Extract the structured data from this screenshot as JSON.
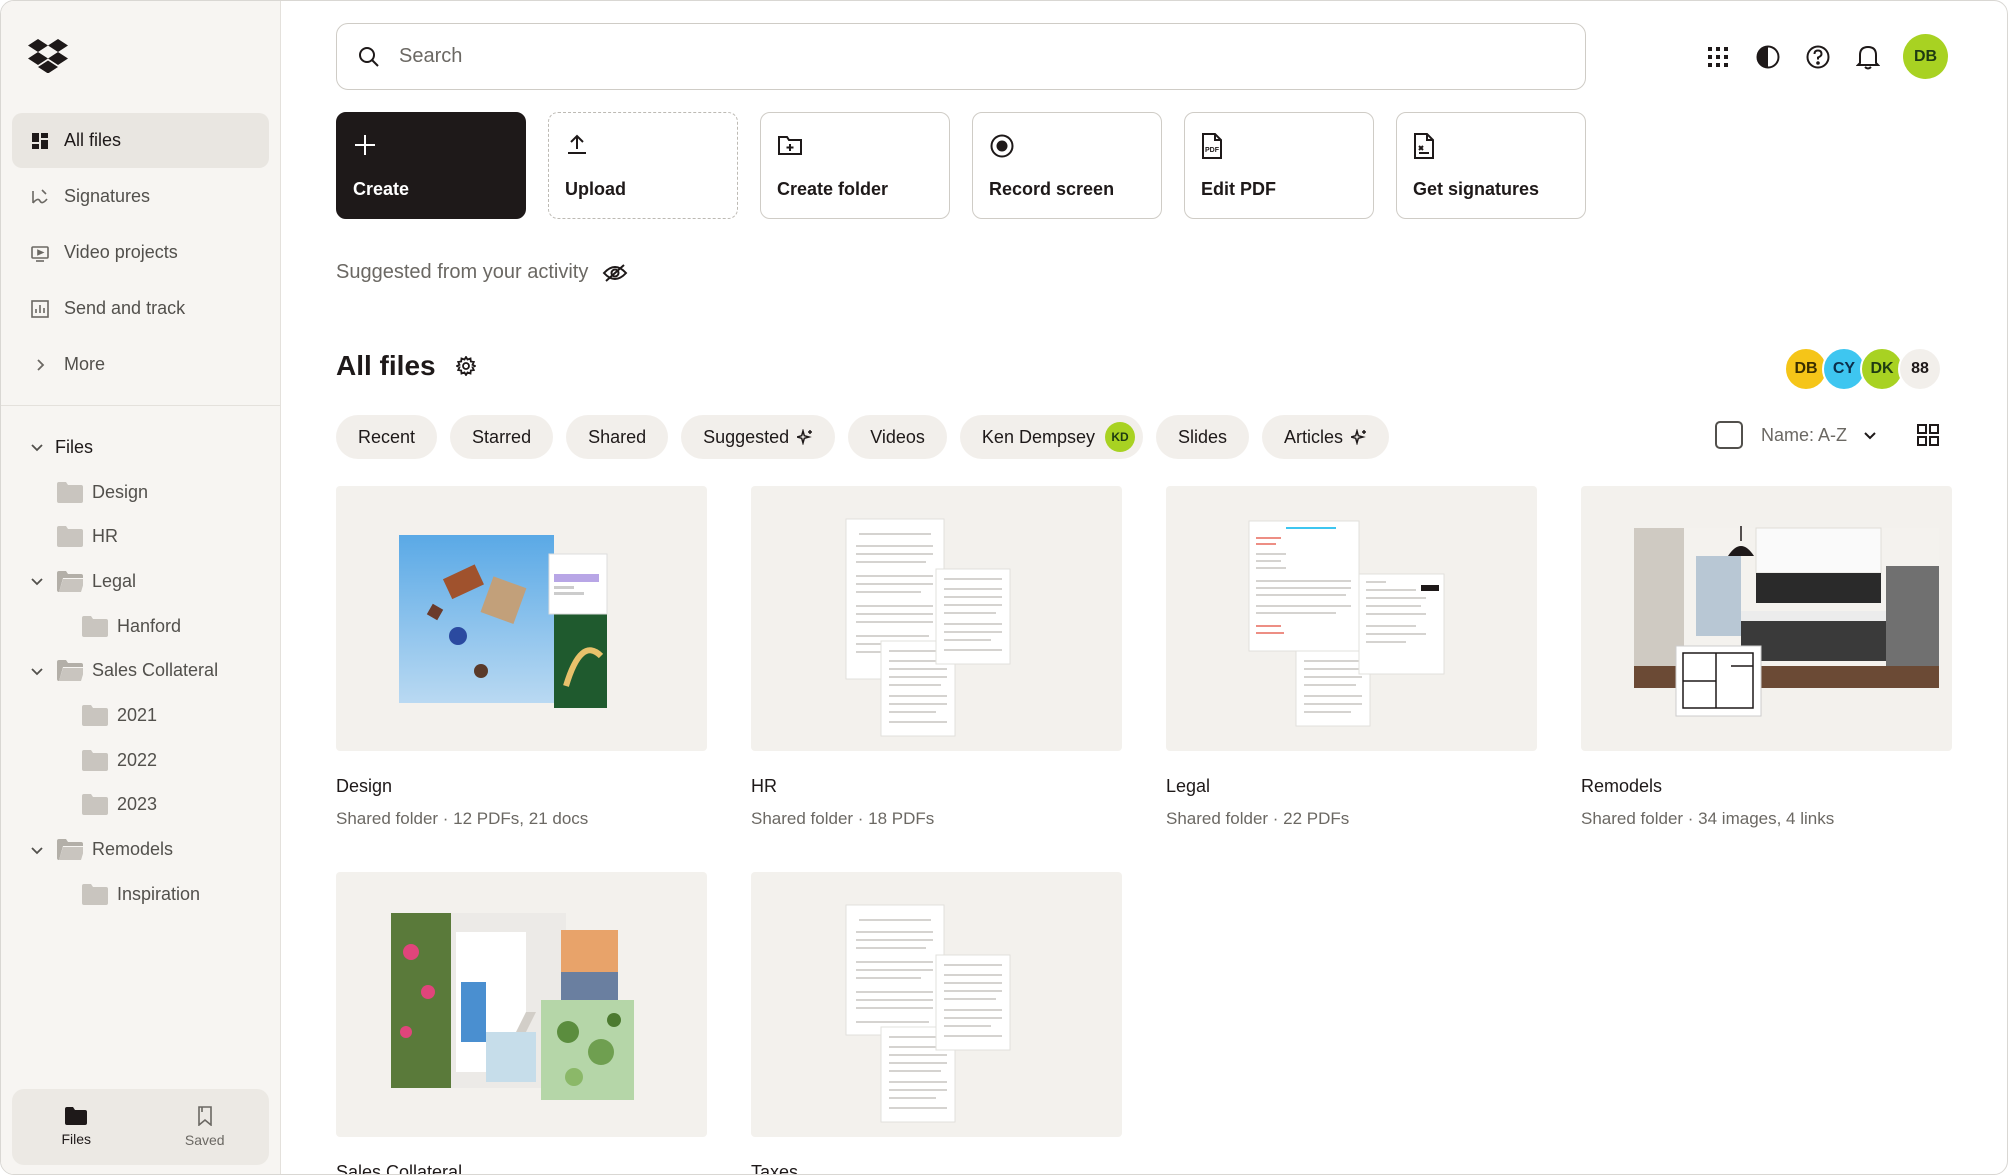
{
  "search": {
    "placeholder": "Search"
  },
  "user": {
    "initials": "DB"
  },
  "sidebar": {
    "nav": [
      {
        "label": "All files",
        "icon": "all-files-icon"
      },
      {
        "label": "Signatures",
        "icon": "signature-icon"
      },
      {
        "label": "Video projects",
        "icon": "video-icon"
      },
      {
        "label": "Send and track",
        "icon": "chart-icon"
      },
      {
        "label": "More",
        "icon": "chevron-right-icon"
      }
    ],
    "tree": [
      {
        "label": "Files"
      },
      {
        "label": "Design"
      },
      {
        "label": "HR"
      },
      {
        "label": "Legal"
      },
      {
        "label": "Hanford"
      },
      {
        "label": "Sales Collateral"
      },
      {
        "label": "2021"
      },
      {
        "label": "2022"
      },
      {
        "label": "2023"
      },
      {
        "label": "Remodels"
      },
      {
        "label": "Inspiration"
      }
    ],
    "bottom_tabs": [
      {
        "label": "Files"
      },
      {
        "label": "Saved"
      }
    ]
  },
  "actions": [
    {
      "label": "Create"
    },
    {
      "label": "Upload"
    },
    {
      "label": "Create folder"
    },
    {
      "label": "Record screen"
    },
    {
      "label": "Edit PDF"
    },
    {
      "label": "Get signatures"
    }
  ],
  "suggested_label": "Suggested from your activity",
  "section_title": "All files",
  "members": [
    {
      "initials": "DB",
      "color": "#f5c518"
    },
    {
      "initials": "CY",
      "color": "#3ec6f0"
    },
    {
      "initials": "DK",
      "color": "#a8d222"
    },
    {
      "initials": "88",
      "color": "#f2efeb"
    }
  ],
  "filters": [
    {
      "label": "Recent"
    },
    {
      "label": "Starred"
    },
    {
      "label": "Shared"
    },
    {
      "label": "Suggested"
    },
    {
      "label": "Videos"
    },
    {
      "label": "Ken Dempsey",
      "badge": "KD"
    },
    {
      "label": "Slides"
    },
    {
      "label": "Articles"
    }
  ],
  "sort": {
    "label": "Name: A-Z"
  },
  "files": [
    {
      "name": "Design",
      "meta": "Shared folder · 12 PDFs, 21 docs"
    },
    {
      "name": "HR",
      "meta": "Shared folder · 18 PDFs"
    },
    {
      "name": "Legal",
      "meta": "Shared folder · 22 PDFs"
    },
    {
      "name": "Remodels",
      "meta": "Shared folder · 34 images, 4 links"
    },
    {
      "name": "Sales Collateral",
      "meta": ""
    },
    {
      "name": "Taxes",
      "meta": ""
    }
  ],
  "colors": {
    "accent": "#1e1919",
    "avatar_green": "#a8d222",
    "sidebar_bg": "#f7f5f2"
  }
}
